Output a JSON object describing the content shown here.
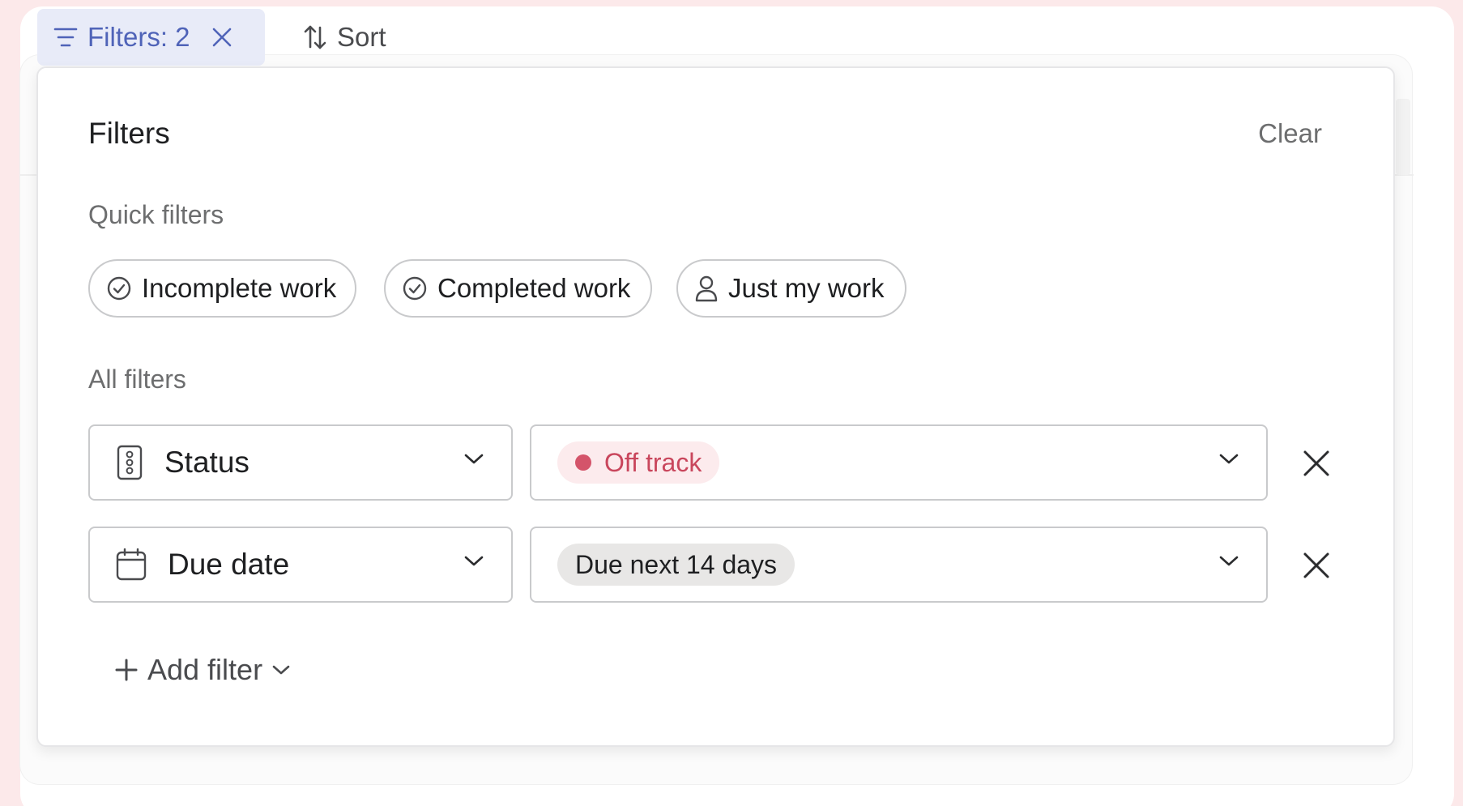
{
  "toolbar": {
    "filters_label": "Filters: 2",
    "sort_label": "Sort"
  },
  "panel": {
    "title": "Filters",
    "clear_label": "Clear",
    "quick_filters_label": "Quick filters",
    "quick_filters": [
      {
        "label": "Incomplete work",
        "icon": "check-circle-icon"
      },
      {
        "label": "Completed work",
        "icon": "check-circle-icon"
      },
      {
        "label": "Just my work",
        "icon": "person-icon"
      }
    ],
    "all_filters_label": "All filters",
    "filters": [
      {
        "field": "Status",
        "field_icon": "status-icon",
        "value": "Off track",
        "value_color": "#c9465c"
      },
      {
        "field": "Due date",
        "field_icon": "calendar-icon",
        "value": "Due next 14 days"
      }
    ],
    "add_filter_label": "Add filter"
  },
  "colors": {
    "accent": "#4f63b8",
    "off_track": "#d4546a",
    "page_background": "#fce9ea"
  }
}
